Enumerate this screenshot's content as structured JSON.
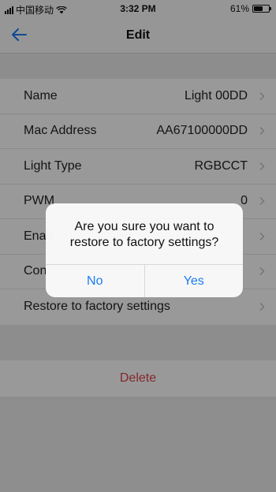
{
  "status_bar": {
    "carrier": "中国移动",
    "time": "3:32 PM",
    "battery_percent": "61%",
    "battery_level": 0.61
  },
  "nav": {
    "title": "Edit",
    "back_icon": "arrow-left-icon",
    "accent_color": "#1a7cf2"
  },
  "settings": [
    {
      "label": "Name",
      "value": "Light 00DD"
    },
    {
      "label": "Mac Address",
      "value": "AA67100000DD"
    },
    {
      "label": "Light Type",
      "value": "RGBCCT"
    },
    {
      "label": "PWM",
      "value": "0"
    },
    {
      "label": "Enab",
      "value": ""
    },
    {
      "label": "Con",
      "value": ""
    },
    {
      "label": "Restore to factory settings",
      "value": ""
    }
  ],
  "delete_label": "Delete",
  "delete_color": "#e0434b",
  "alert": {
    "message": "Are you sure you want to restore to factory settings?",
    "cancel_label": "No",
    "confirm_label": "Yes"
  }
}
